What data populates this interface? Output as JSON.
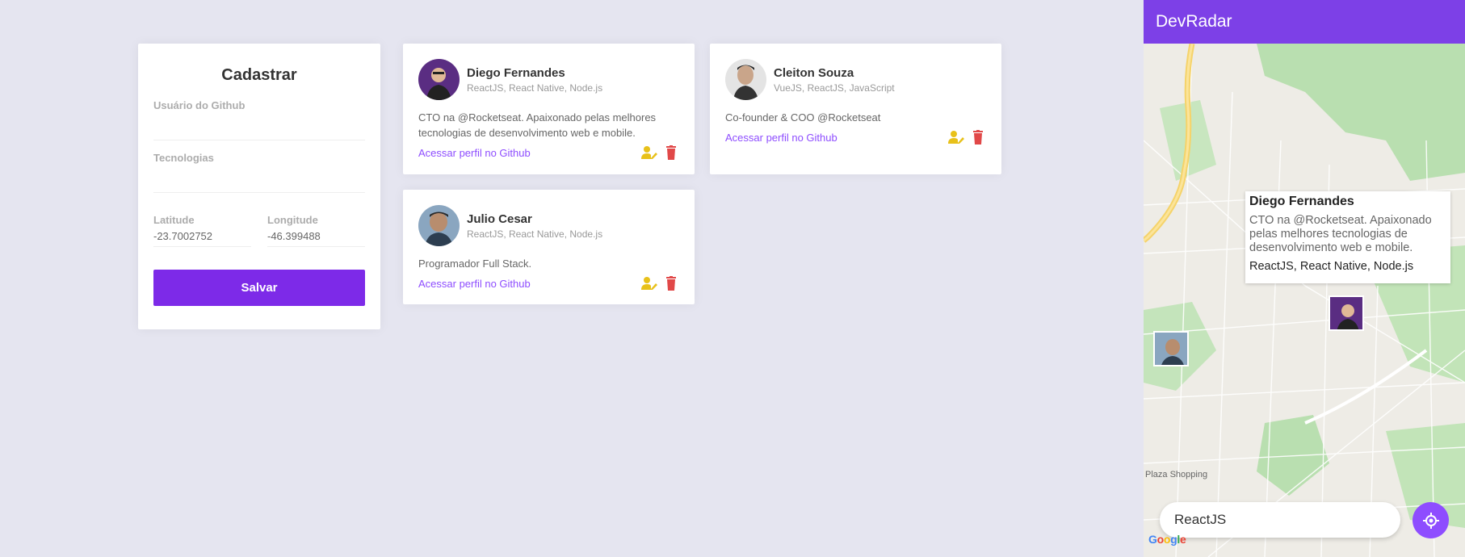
{
  "form": {
    "title": "Cadastrar",
    "github_label": "Usuário do Github",
    "github_value": "",
    "techs_label": "Tecnologias",
    "techs_value": "",
    "latitude_label": "Latitude",
    "latitude_value": "-23.7002752",
    "longitude_label": "Longitude",
    "longitude_value": "-46.399488",
    "save_label": "Salvar"
  },
  "devs": [
    {
      "name": "Diego Fernandes",
      "techs": "ReactJS, React Native, Node.js",
      "bio": "CTO na @Rocketseat. Apaixonado pelas melhores tecnologias de desenvolvimento web e mobile.",
      "link": "Acessar perfil no Github",
      "avatar_color": "#5a2d82"
    },
    {
      "name": "Cleiton Souza",
      "techs": "VueJS, ReactJS, JavaScript",
      "bio": "Co-founder & COO @Rocketseat",
      "link": "Acessar perfil no Github",
      "avatar_color": "#d9d9d9"
    },
    {
      "name": "Julio Cesar",
      "techs": "ReactJS, React Native, Node.js",
      "bio": "Programador Full Stack.",
      "link": "Acessar perfil no Github",
      "avatar_color": "#8aa6c0"
    }
  ],
  "colors": {
    "accent": "#7d2ae8",
    "link": "#8e4dff",
    "edit_icon": "#e8c11a",
    "delete_icon": "#e14848",
    "background": "#e5e5f0"
  },
  "mobile": {
    "app_title": "DevRadar",
    "callout": {
      "name": "Diego Fernandes",
      "bio": "CTO na @Rocketseat. Apaixonado pelas melhores tecnologias de desenvolvimento web e mobile.",
      "techs": "ReactJS, React Native, Node.js"
    },
    "search_value": "ReactJS",
    "map_label": "Plaza Shopping",
    "google_logo": "Google",
    "locate_icon": "my-location-icon"
  }
}
